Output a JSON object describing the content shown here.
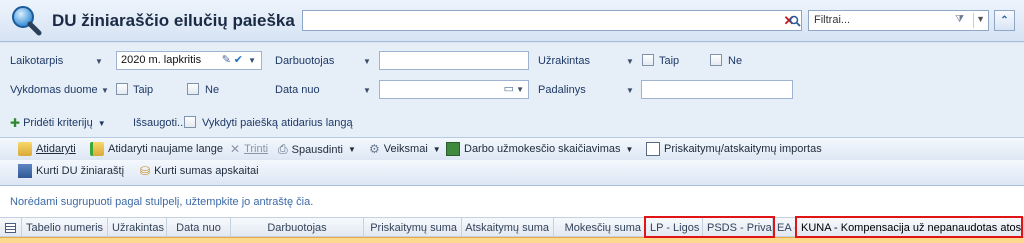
{
  "header": {
    "title": "DU žiniaraščio eilučių paieška",
    "search_value": "",
    "filter_placeholder": "Filtrai..."
  },
  "criteria": {
    "laikotarpis_label": "Laikotarpis",
    "laikotarpis_value": "2020 m. lapkritis",
    "darbuotojas_label": "Darbuotojas",
    "darbuotojas_value": "",
    "uzrakintas_label": "Užrakintas",
    "taip_label": "Taip",
    "ne_label": "Ne",
    "vykdomas_label": "Vykdomas duome",
    "data_nuo_label": "Data nuo",
    "data_nuo_value": "",
    "padalinys_label": "Padalinys",
    "padalinys_value": "",
    "prideti_label": "Pridėti kriterijų",
    "issaugoti_label": "Išsaugoti...",
    "vykdyti_label": "Vykdyti paiešką atidarius langą"
  },
  "toolbar": {
    "atidaryti": "Atidaryti",
    "atidaryti_naujame": "Atidaryti naujame lange",
    "trinti": "Trinti",
    "spausdinti": "Spausdinti",
    "veiksmai": "Veiksmai",
    "darbo_uzmokescio": "Darbo užmokesčio skaičiavimas",
    "priskaitymu_importas": "Priskaitymų/atskaitymų importas",
    "kurti_du": "Kurti DU žiniaraštį",
    "kurti_sumas": "Kurti sumas apskaitai"
  },
  "grid": {
    "group_hint": "Norėdami sugrupuoti pagal stulpelį, užtempkite jo antraštę čia.",
    "columns": [
      "Tabelio numeris",
      "Užrakintas",
      "Data nuo",
      "Darbuotojas",
      "Priskaitymų suma",
      "Atskaitymų suma",
      "Mokesčių suma",
      "LP - Ligos p",
      "PSDS - Privalo",
      "EA -",
      "KUNA - Kompensacija už nepanaudotas atostogas"
    ]
  },
  "colors": {
    "accent": "#1f5fae",
    "highlight_border": "#e01414",
    "selected_row": "#fbd98f"
  }
}
